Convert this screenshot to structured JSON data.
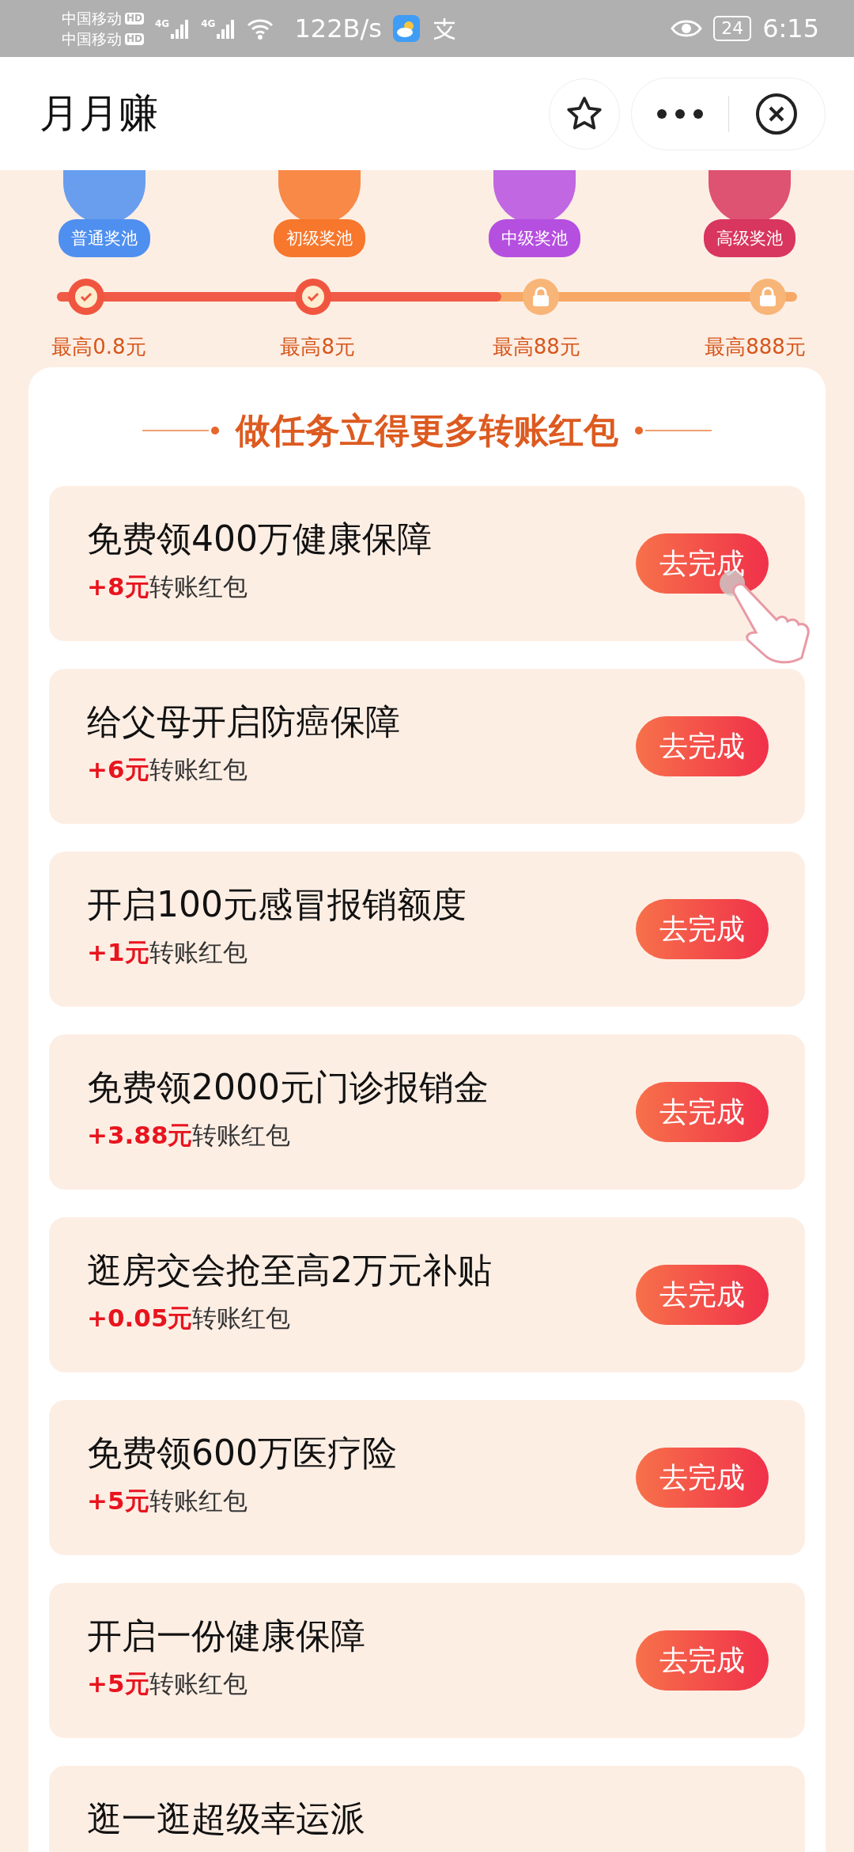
{
  "status_bar": {
    "carriers": [
      "中国移动",
      "中国移动"
    ],
    "hd_badges": [
      "HD",
      "HD"
    ],
    "network": [
      "4G",
      "4G"
    ],
    "speed": "122B/s",
    "battery": "24",
    "time": "6:15"
  },
  "header": {
    "title": "月月赚"
  },
  "tiers": {
    "progress": {
      "level": 0.6
    },
    "items": [
      {
        "label": "普通奖池",
        "reward": "最高0.8元",
        "unlocked": true,
        "color": "#4f8ff0"
      },
      {
        "label": "初级奖池",
        "reward": "最高8元",
        "unlocked": true,
        "color": "#f7772c"
      },
      {
        "label": "中级奖池",
        "reward": "最高88元",
        "unlocked": false,
        "color": "#b54fe0"
      },
      {
        "label": "高级奖池",
        "reward": "最高888元",
        "unlocked": false,
        "color": "#d8365e"
      }
    ]
  },
  "tasks_panel": {
    "heading": "做任务立得更多转账红包",
    "tasks": [
      {
        "title": "免费领400万健康保障",
        "bonus": "+8元",
        "bonus_label": "转账红包",
        "button": "去完成",
        "pointer": true
      },
      {
        "title": "给父母开启防癌保障",
        "bonus": "+6元",
        "bonus_label": "转账红包",
        "button": "去完成",
        "pointer": false
      },
      {
        "title": "开启100元感冒报销额度",
        "bonus": "+1元",
        "bonus_label": "转账红包",
        "button": "去完成",
        "pointer": false
      },
      {
        "title": "免费领2000元门诊报销金",
        "bonus": "+3.88元",
        "bonus_label": "转账红包",
        "button": "去完成",
        "pointer": false
      },
      {
        "title": "逛房交会抢至高2万元补贴",
        "bonus": "+0.05元",
        "bonus_label": "转账红包",
        "button": "去完成",
        "pointer": false
      },
      {
        "title": "免费领600万医疗险",
        "bonus": "+5元",
        "bonus_label": "转账红包",
        "button": "去完成",
        "pointer": false
      },
      {
        "title": "开启一份健康保障",
        "bonus": "+5元",
        "bonus_label": "转账红包",
        "button": "去完成",
        "pointer": false
      },
      {
        "title": "逛一逛超级幸运派",
        "pointer": false
      }
    ]
  }
}
